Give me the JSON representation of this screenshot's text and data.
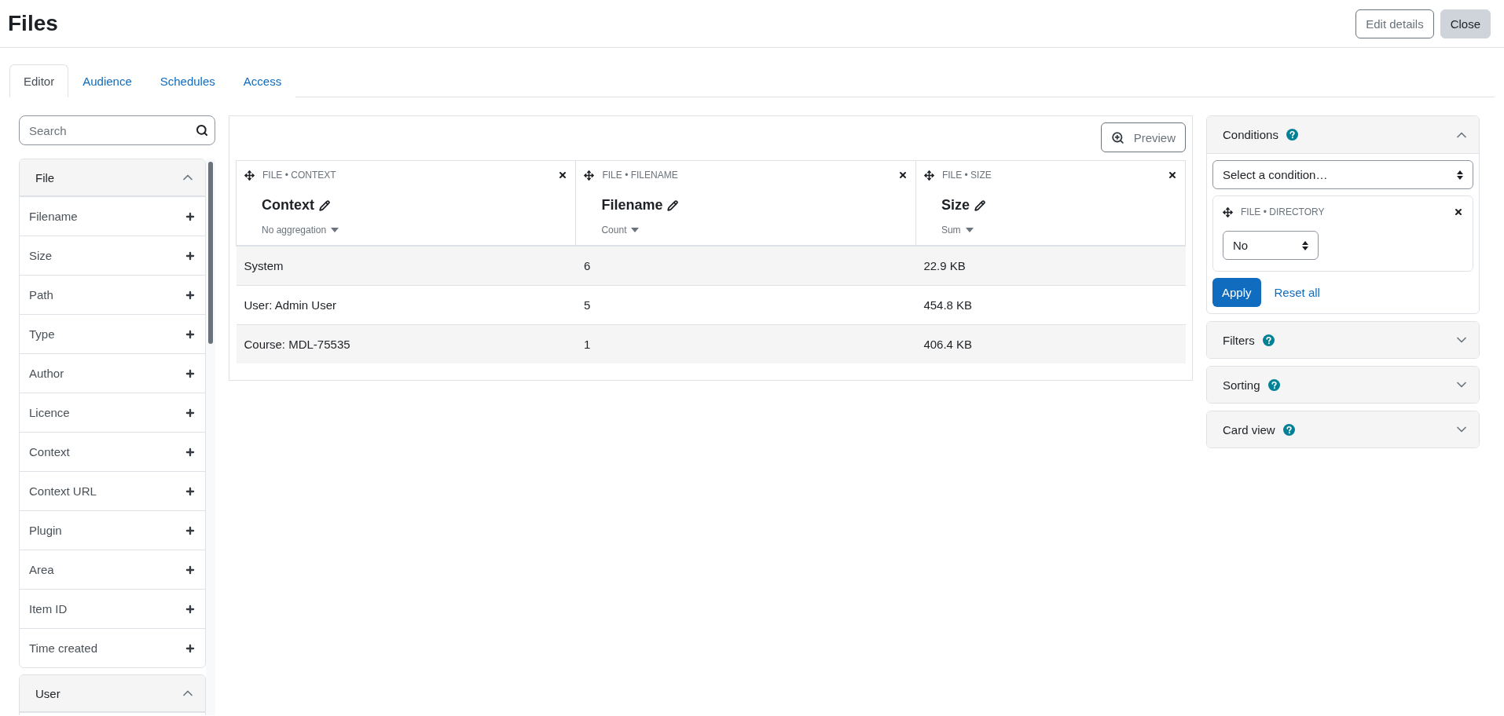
{
  "page": {
    "title": "Files",
    "actions": [
      {
        "label": "Edit details",
        "kind": "outline"
      },
      {
        "label": "Close",
        "kind": "secondary"
      }
    ]
  },
  "tabs": [
    {
      "label": "Editor",
      "selected": true
    },
    {
      "label": "Audience",
      "selected": false
    },
    {
      "label": "Schedules",
      "selected": false
    },
    {
      "label": "Access",
      "selected": false
    }
  ],
  "search": {
    "placeholder": "Search"
  },
  "sidebar": {
    "groups": [
      {
        "title": "File",
        "expanded": true,
        "items": [
          "Filename",
          "Size",
          "Path",
          "Type",
          "Author",
          "Licence",
          "Context",
          "Context URL",
          "Plugin",
          "Area",
          "Item ID",
          "Time created"
        ]
      },
      {
        "title": "User",
        "expanded": true
      }
    ]
  },
  "report": {
    "preview_button": "Preview",
    "columns": [
      {
        "source": "FILE • CONTEXT",
        "title": "Context",
        "aggregation": "No aggregation"
      },
      {
        "source": "FILE • FILENAME",
        "title": "Filename",
        "aggregation": "Count"
      },
      {
        "source": "FILE • SIZE",
        "title": "Size",
        "aggregation": "Sum"
      }
    ],
    "rows": [
      [
        "System",
        "6",
        "22.9 KB"
      ],
      [
        "User: Admin User",
        "5",
        "454.8 KB"
      ],
      [
        "Course: MDL-75535",
        "1",
        "406.4 KB"
      ]
    ]
  },
  "settings": {
    "sections": [
      {
        "title": "Conditions",
        "expanded": true
      },
      {
        "title": "Filters",
        "expanded": false
      },
      {
        "title": "Sorting",
        "expanded": false
      },
      {
        "title": "Card view",
        "expanded": false
      }
    ],
    "conditions": {
      "select": "Select a condition…",
      "items": [
        {
          "source": "FILE • DIRECTORY",
          "value": "No"
        }
      ],
      "apply": "Apply",
      "reset": "Reset all"
    }
  }
}
